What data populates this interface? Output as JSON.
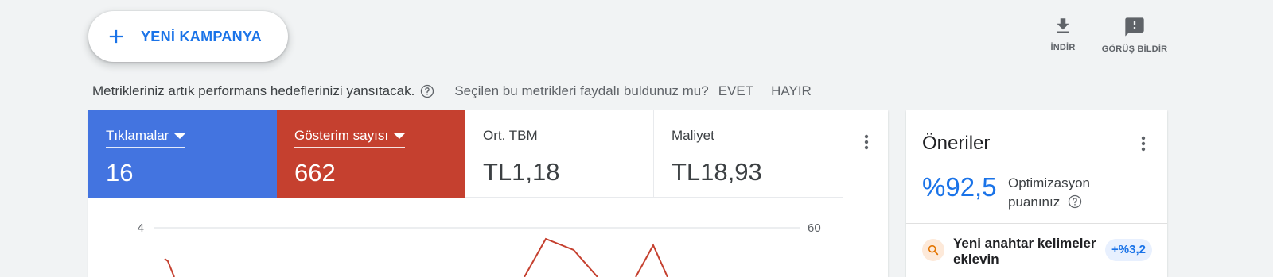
{
  "header": {
    "new_campaign_label": "YENİ KAMPANYA",
    "actions": [
      {
        "label": "İNDİR",
        "icon": "download-icon"
      },
      {
        "label": "GÖRÜŞ BİLDİR",
        "icon": "feedback-icon"
      }
    ]
  },
  "banner": {
    "message": "Metrikleriniz artık performans hedeflerinizi yansıtacak.",
    "question": "Seçilen bu metrikleri faydalı buldunuz mu?",
    "yes_label": "EVET",
    "no_label": "HAYIR"
  },
  "metrics": [
    {
      "label": "Tıklamalar",
      "value": "16",
      "selected": true,
      "color": "#4374e0"
    },
    {
      "label": "Gösterim sayısı",
      "value": "662",
      "selected": true,
      "color": "#c5402f"
    },
    {
      "label": "Ort. TBM",
      "value": "TL1,18",
      "selected": false
    },
    {
      "label": "Maliyet",
      "value": "TL18,93",
      "selected": false
    }
  ],
  "chart_data": {
    "type": "line",
    "y_left_ticks": [
      "4"
    ],
    "y_right_ticks": [
      "60"
    ]
  },
  "recommendations": {
    "title": "Öneriler",
    "score": "%92,5",
    "score_label_line1": "Optimizasyon",
    "score_label_line2": "puanınız",
    "items": [
      {
        "text": "Yeni anahtar kelimeler eklevin",
        "badge": "+%3,2",
        "icon": "search-icon"
      }
    ]
  },
  "colors": {
    "accent": "#1a73e8",
    "clicks": "#4374e0",
    "impressions": "#c5402f",
    "background": "#f1f3f4"
  }
}
